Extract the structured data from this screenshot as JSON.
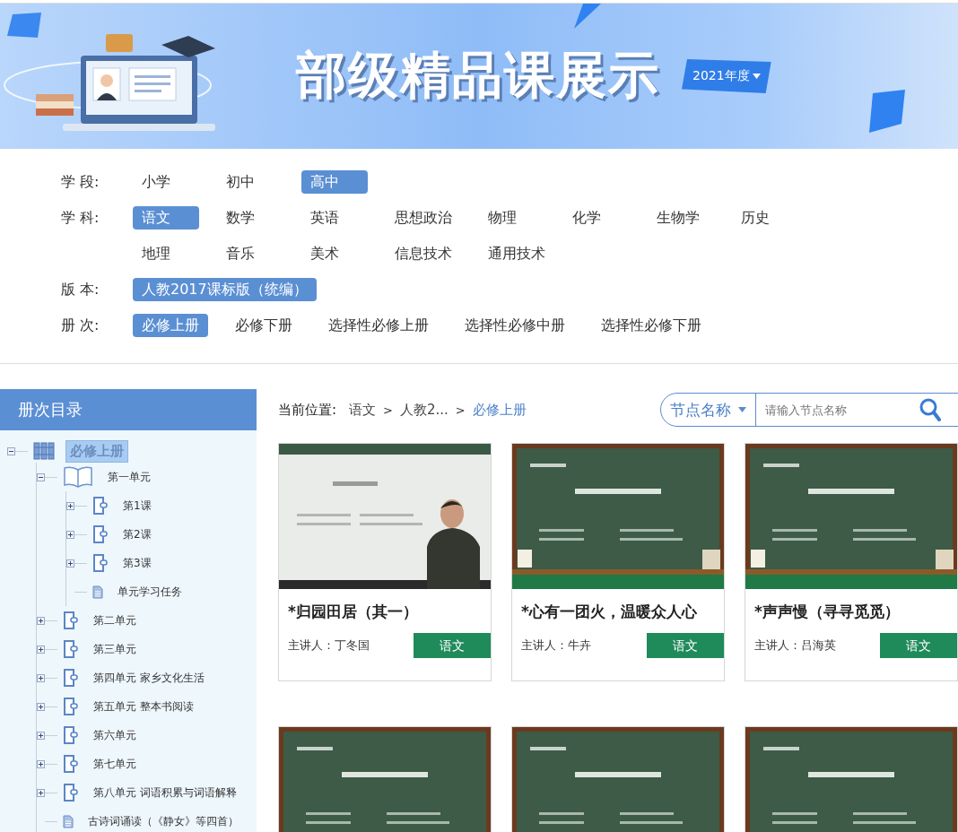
{
  "banner": {
    "title": "部级精品课展示",
    "year": "2021年度"
  },
  "filters": [
    {
      "label": "学 段:",
      "options": [
        {
          "label": "小学",
          "selected": false
        },
        {
          "label": "初中",
          "selected": false
        },
        {
          "label": "高中",
          "selected": true
        }
      ]
    },
    {
      "label": "学 科:",
      "options": [
        {
          "label": "语文",
          "selected": true
        },
        {
          "label": "数学",
          "selected": false
        },
        {
          "label": "英语",
          "selected": false
        },
        {
          "label": "思想政治",
          "selected": false
        },
        {
          "label": "物理",
          "selected": false
        },
        {
          "label": "化学",
          "selected": false
        },
        {
          "label": "生物学",
          "selected": false
        },
        {
          "label": "历史",
          "selected": false
        },
        {
          "label": "地理",
          "selected": false
        },
        {
          "label": "音乐",
          "selected": false
        },
        {
          "label": "美术",
          "selected": false
        },
        {
          "label": "信息技术",
          "selected": false
        },
        {
          "label": "通用技术",
          "selected": false
        }
      ]
    },
    {
      "label": "版 本:",
      "options": [
        {
          "label": "人教2017课标版（统编）",
          "selected": true
        }
      ]
    },
    {
      "label": "册 次:",
      "options": [
        {
          "label": "必修上册",
          "selected": true
        },
        {
          "label": "必修下册",
          "selected": false
        },
        {
          "label": "选择性必修上册",
          "selected": false
        },
        {
          "label": "选择性必修中册",
          "selected": false
        },
        {
          "label": "选择性必修下册",
          "selected": false
        }
      ]
    }
  ],
  "sidebar": {
    "title": "册次目录",
    "tree": [
      {
        "label": "必修上册",
        "kind": "books",
        "expanded": true,
        "selected": true,
        "children": [
          {
            "label": "第一单元",
            "kind": "open-book",
            "expanded": true,
            "selected": false,
            "children": [
              {
                "label": "第1课",
                "kind": "lesson",
                "expanded": false,
                "selected": false
              },
              {
                "label": "第2课",
                "kind": "lesson",
                "expanded": false,
                "selected": false
              },
              {
                "label": "第3课",
                "kind": "lesson",
                "expanded": false,
                "selected": false
              },
              {
                "label": "单元学习任务",
                "kind": "file",
                "selected": false
              }
            ]
          },
          {
            "label": "第二单元",
            "kind": "lesson",
            "expanded": false,
            "selected": false
          },
          {
            "label": "第三单元",
            "kind": "lesson",
            "expanded": false,
            "selected": false
          },
          {
            "label": "第四单元  家乡文化生活",
            "kind": "lesson",
            "expanded": false,
            "selected": false
          },
          {
            "label": "第五单元  整本书阅读",
            "kind": "lesson",
            "expanded": false,
            "selected": false
          },
          {
            "label": "第六单元",
            "kind": "lesson",
            "expanded": false,
            "selected": false
          },
          {
            "label": "第七单元",
            "kind": "lesson",
            "expanded": false,
            "selected": false
          },
          {
            "label": "第八单元  词语积累与词语解释",
            "kind": "lesson",
            "expanded": false,
            "selected": false
          },
          {
            "label": "古诗词诵读（《静女》等四首）",
            "kind": "file",
            "selected": false
          }
        ]
      }
    ]
  },
  "breadcrumb": {
    "label": "当前位置:",
    "items": [
      "语文",
      "人教2...",
      "必修上册"
    ],
    "separator": ">"
  },
  "search": {
    "scope": "节点名称",
    "placeholder": "请输入节点名称"
  },
  "cards": [
    {
      "title": "*归园田居（其一）",
      "lecturer": "主讲人：丁冬国",
      "subject": "语文"
    },
    {
      "title": "*心有一团火，温暖众人心",
      "lecturer": "主讲人：牛卉",
      "subject": "语文"
    },
    {
      "title": "*声声慢（寻寻觅觅）",
      "lecturer": "主讲人：吕海英",
      "subject": "语文"
    },
    {
      "kind": "picture"
    },
    {
      "kind": "picture"
    },
    {
      "kind": "picture"
    }
  ]
}
